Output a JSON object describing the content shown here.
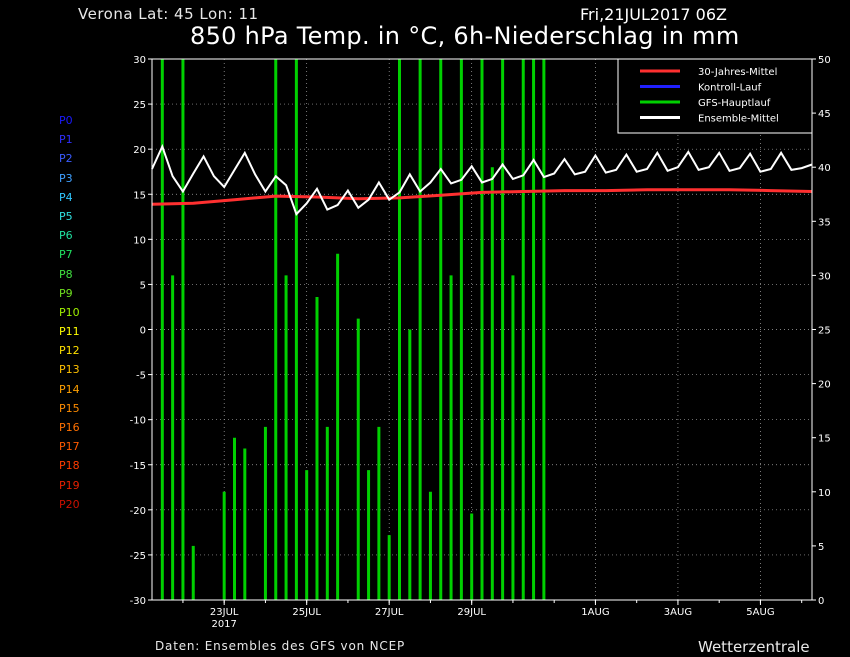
{
  "header": {
    "location": "Verona   Lat: 45 Lon: 11",
    "date": "Fri,21JUL2017 06Z",
    "title": "850 hPa Temp. in °C, 6h-Niederschlag in mm"
  },
  "footer": {
    "credit": "Daten: Ensembles des GFS von NCEP",
    "brand": "Wetterzentrale"
  },
  "members": [
    {
      "label": "P0",
      "color": "#1a1aff"
    },
    {
      "label": "P1",
      "color": "#2f2fff"
    },
    {
      "label": "P2",
      "color": "#3a5cff"
    },
    {
      "label": "P3",
      "color": "#3fa0ff"
    },
    {
      "label": "P4",
      "color": "#30c8ff"
    },
    {
      "label": "P5",
      "color": "#30e0e0"
    },
    {
      "label": "P6",
      "color": "#20e0a0"
    },
    {
      "label": "P7",
      "color": "#20e060"
    },
    {
      "label": "P8",
      "color": "#40e040"
    },
    {
      "label": "P9",
      "color": "#70e020"
    },
    {
      "label": "P10",
      "color": "#a0f000"
    },
    {
      "label": "P11",
      "color": "#ffff00"
    },
    {
      "label": "P12",
      "color": "#ffe000"
    },
    {
      "label": "P13",
      "color": "#ffc000"
    },
    {
      "label": "P14",
      "color": "#ffa000"
    },
    {
      "label": "P15",
      "color": "#ff8c00"
    },
    {
      "label": "P16",
      "color": "#ff7000"
    },
    {
      "label": "P17",
      "color": "#ff5a00"
    },
    {
      "label": "P18",
      "color": "#ff3c00"
    },
    {
      "label": "P19",
      "color": "#e62000"
    },
    {
      "label": "P20",
      "color": "#cc1000"
    }
  ],
  "chart_data": {
    "type": "line",
    "x_unit": "hours since 21JUL2017 06Z",
    "xlim": [
      0,
      384
    ],
    "ylim_left": [
      -30,
      30
    ],
    "ylim_right": [
      0,
      50
    ],
    "yticks_left": [
      30,
      25,
      20,
      15,
      10,
      5,
      0,
      -5,
      -10,
      -15,
      -20,
      -25,
      -30
    ],
    "yticks_right": [
      50,
      45,
      40,
      35,
      30,
      25,
      20,
      15,
      10,
      5,
      0
    ],
    "xticks": [
      {
        "x": 42,
        "label": "23JUL",
        "label2": "2017"
      },
      {
        "x": 90,
        "label": "25JUL"
      },
      {
        "x": 138,
        "label": "27JUL"
      },
      {
        "x": 186,
        "label": "29JUL"
      },
      {
        "x": 258,
        "label": "1AUG"
      },
      {
        "x": 306,
        "label": "3AUG"
      },
      {
        "x": 354,
        "label": "5AUG"
      }
    ],
    "grid": true,
    "legend_position": "top-right",
    "legend": [
      {
        "name": "30-Jahres-Mittel",
        "color": "#ff3030"
      },
      {
        "name": "Kontroll-Lauf",
        "color": "#2020ff"
      },
      {
        "name": "GFS-Hauptlauf",
        "color": "#00d000"
      },
      {
        "name": "Ensemble-Mittel",
        "color": "#ffffff"
      }
    ],
    "series": [
      {
        "name": "30-Jahres-Mittel",
        "axis": "left",
        "color": "#ff3030",
        "x": [
          0,
          24,
          48,
          72,
          96,
          120,
          144,
          168,
          192,
          216,
          240,
          264,
          288,
          312,
          336,
          360,
          384
        ],
        "values": [
          13.9,
          14.0,
          14.4,
          14.8,
          14.7,
          14.5,
          14.6,
          14.9,
          15.2,
          15.3,
          15.4,
          15.4,
          15.5,
          15.5,
          15.5,
          15.4,
          15.3
        ]
      },
      {
        "name": "Ensemble-Mittel",
        "axis": "left",
        "color": "#ffffff",
        "x": [
          0,
          6,
          12,
          18,
          24,
          30,
          36,
          42,
          48,
          54,
          60,
          66,
          72,
          78,
          84,
          90,
          96,
          102,
          108,
          114,
          120,
          126,
          132,
          138,
          144,
          150,
          156,
          162,
          168,
          174,
          180,
          186,
          192,
          198,
          204,
          210,
          216,
          222,
          228,
          234,
          240,
          246,
          252,
          258,
          264,
          270,
          276,
          282,
          288,
          294,
          300,
          306,
          312,
          318,
          324,
          330,
          336,
          342,
          348,
          354,
          360,
          366,
          372,
          378,
          384
        ],
        "values": [
          17.8,
          20.3,
          17.0,
          15.3,
          17.3,
          19.2,
          17.0,
          15.8,
          17.7,
          19.6,
          17.2,
          15.3,
          17.0,
          16.0,
          12.8,
          14.0,
          15.6,
          13.3,
          13.8,
          15.4,
          13.5,
          14.4,
          16.3,
          14.4,
          15.2,
          17.2,
          15.3,
          16.3,
          17.8,
          16.2,
          16.6,
          18.1,
          16.3,
          16.7,
          18.3,
          16.7,
          17.1,
          18.8,
          16.9,
          17.3,
          18.9,
          17.2,
          17.5,
          19.3,
          17.4,
          17.7,
          19.4,
          17.5,
          17.8,
          19.6,
          17.6,
          18.0,
          19.7,
          17.7,
          18.0,
          19.6,
          17.6,
          17.9,
          19.5,
          17.5,
          17.8,
          19.6,
          17.7,
          17.9,
          18.3
        ]
      }
    ],
    "precipitation": {
      "axis": "right",
      "unit": "mm",
      "note": "GFS-Hauptlauf 6h precipitation bars (green)",
      "x": [
        6,
        12,
        18,
        24,
        42,
        48,
        54,
        66,
        72,
        78,
        84,
        90,
        96,
        102,
        108,
        114,
        120,
        126,
        132,
        138,
        144,
        150,
        156,
        162,
        168,
        174,
        180,
        186,
        192,
        198,
        204,
        210,
        216,
        222,
        228,
        234
      ],
      "values": [
        50,
        30,
        50,
        5,
        10,
        15,
        14,
        16,
        50,
        30,
        50,
        12,
        28,
        16,
        32,
        0,
        26,
        12,
        16,
        6,
        50,
        25,
        50,
        10,
        50,
        30,
        50,
        8,
        50,
        40,
        50,
        30,
        50,
        50,
        50,
        0
      ]
    }
  }
}
